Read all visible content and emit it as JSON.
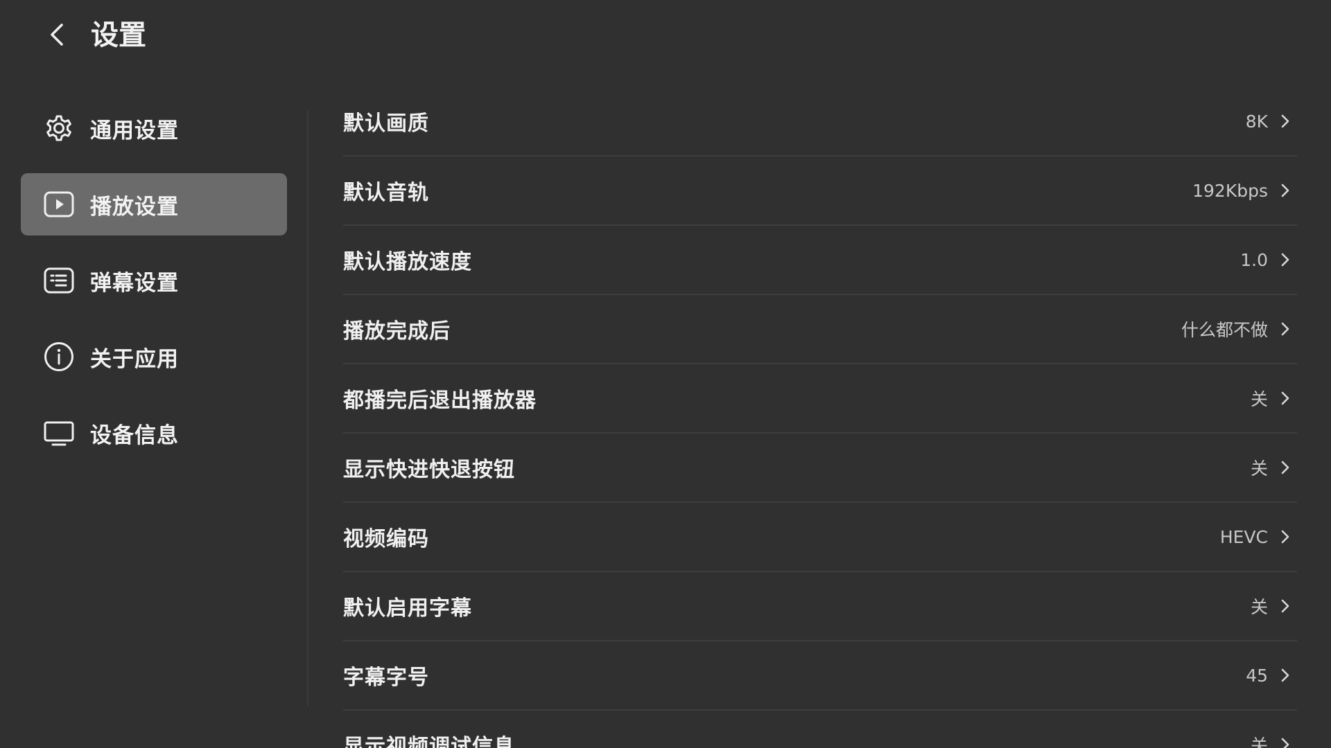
{
  "header": {
    "title": "设置",
    "back_icon": "chevron-left-icon"
  },
  "sidebar": {
    "items": [
      {
        "label": "通用设置",
        "icon": "gear-icon",
        "active": false
      },
      {
        "label": "播放设置",
        "icon": "play-icon",
        "active": true
      },
      {
        "label": "弹幕设置",
        "icon": "danmaku-icon",
        "active": false
      },
      {
        "label": "关于应用",
        "icon": "info-icon",
        "active": false
      },
      {
        "label": "设备信息",
        "icon": "monitor-icon",
        "active": false
      }
    ]
  },
  "settings": {
    "rows": [
      {
        "label": "默认画质",
        "value": "8K"
      },
      {
        "label": "默认音轨",
        "value": "192Kbps"
      },
      {
        "label": "默认播放速度",
        "value": "1.0"
      },
      {
        "label": "播放完成后",
        "value": "什么都不做"
      },
      {
        "label": "都播完后退出播放器",
        "value": "关"
      },
      {
        "label": "显示快进快退按钮",
        "value": "关"
      },
      {
        "label": "视频编码",
        "value": "HEVC"
      },
      {
        "label": "默认启用字幕",
        "value": "关"
      },
      {
        "label": "字幕字号",
        "value": "45"
      },
      {
        "label": "显示视频调试信息",
        "value": "关"
      }
    ]
  },
  "colors": {
    "background": "#303030",
    "active_item": "#6b6b6b",
    "divider": "#3e3e3e",
    "text_primary": "#f0f0f0",
    "text_secondary": "#c8c8c8"
  }
}
